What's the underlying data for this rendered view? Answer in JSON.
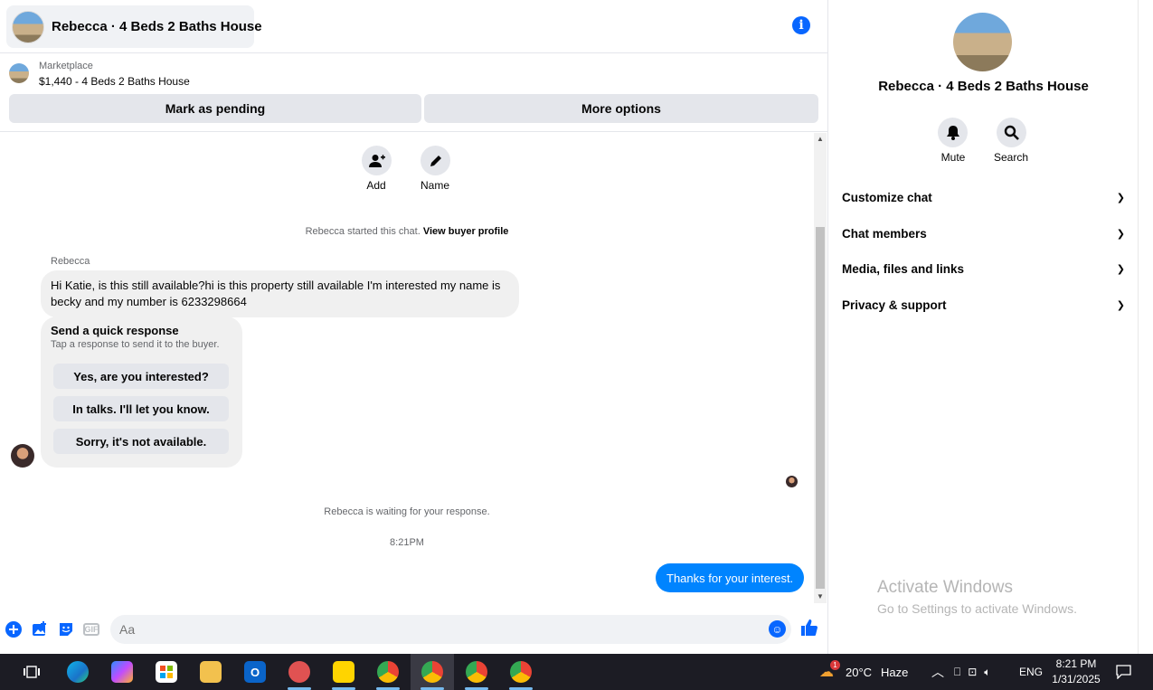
{
  "header": {
    "title": "Rebecca · 4 Beds 2 Baths House",
    "info_icon": "info-icon"
  },
  "listing": {
    "source": "Marketplace",
    "title": "$1,440 - 4 Beds 2 Baths House",
    "mark_pending": "Mark as pending",
    "more_options": "More options"
  },
  "actions": {
    "add": "Add",
    "name": "Name"
  },
  "chat": {
    "started_text": "Rebecca started this chat.",
    "view_profile": "View buyer profile",
    "sender": "Rebecca",
    "message": "Hi Katie, is this still available?hi is this property  still available  I'm interested my name is becky and my number is 6233298664",
    "quick_title": "Send a quick response",
    "quick_sub": "Tap a response to send it to the buyer.",
    "quick_options": [
      "Yes, are you interested?",
      "In talks. I'll let you know.",
      "Sorry, it's not available."
    ],
    "waiting": "Rebecca is waiting for your response.",
    "time": "8:21PM",
    "outgoing": "Thanks for your interest."
  },
  "composer": {
    "placeholder": "Aa",
    "gif_label": "GIF"
  },
  "panel": {
    "title": "Rebecca · 4 Beds 2 Baths House",
    "mute": "Mute",
    "search": "Search",
    "sections": [
      "Customize chat",
      "Chat members",
      "Media, files and links",
      "Privacy & support"
    ]
  },
  "watermark": {
    "line1": "Activate Windows",
    "line2": "Go to Settings to activate Windows."
  },
  "taskbar": {
    "weather_badge": "1",
    "temperature": "20°C",
    "weather": "Haze",
    "language": "ENG",
    "time": "8:21 PM",
    "date": "1/31/2025"
  },
  "colors": {
    "accent": "#0866ff",
    "outgoing_bubble": "#0084ff",
    "incoming_bubble": "#f0f0f0"
  }
}
